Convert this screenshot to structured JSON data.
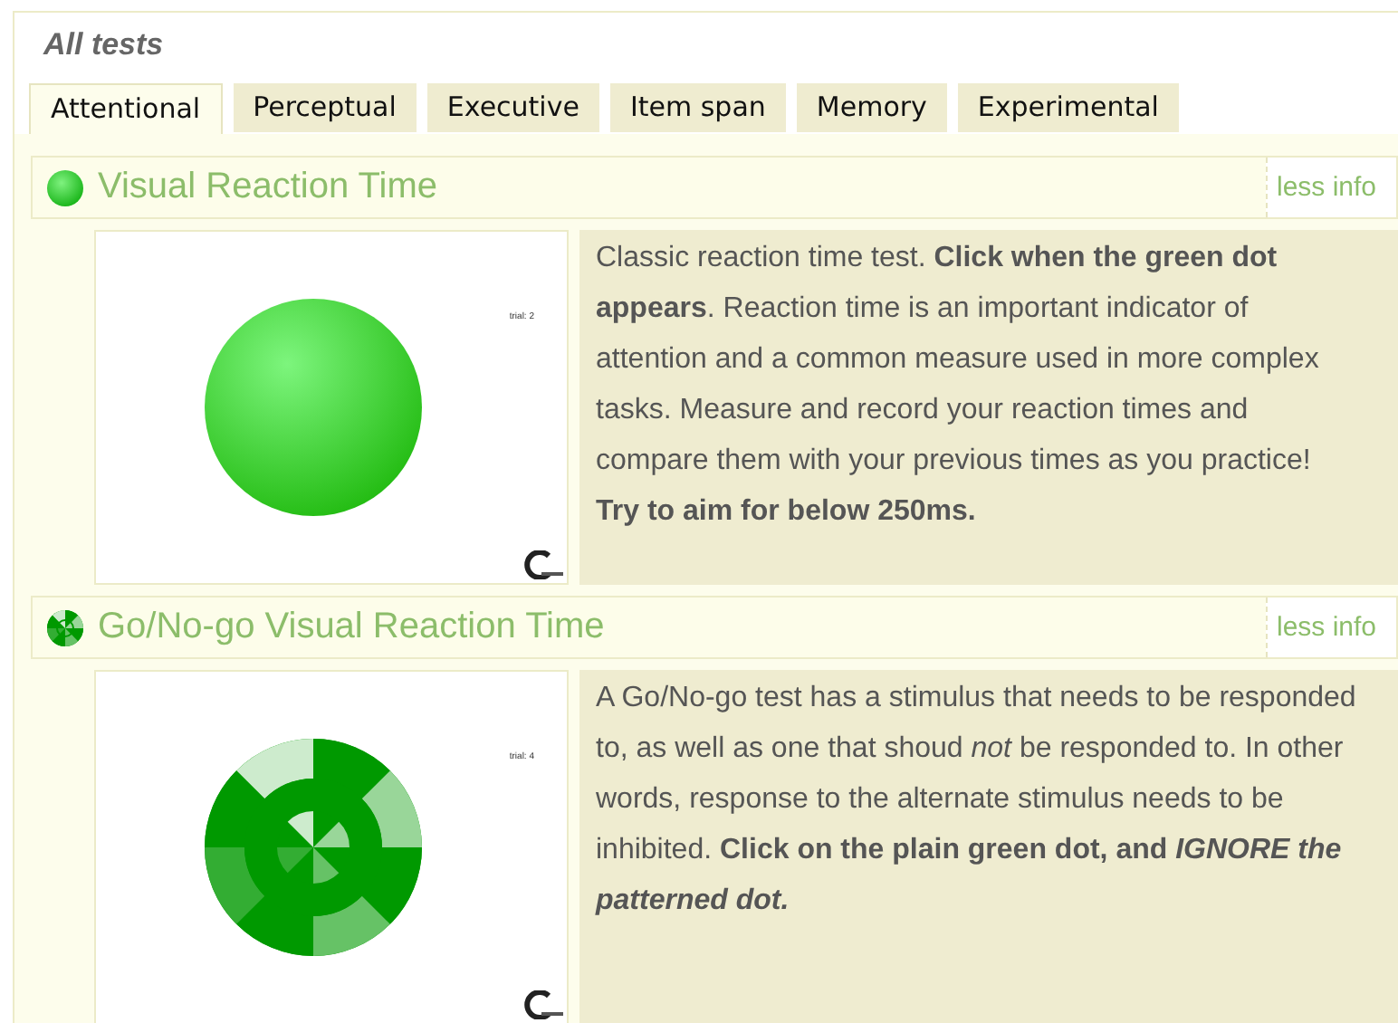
{
  "heading": "All tests",
  "tabs": [
    {
      "label": "Attentional",
      "selected": true
    },
    {
      "label": "Perceptual",
      "selected": false
    },
    {
      "label": "Executive",
      "selected": false
    },
    {
      "label": "Item span",
      "selected": false
    },
    {
      "label": "Memory",
      "selected": false
    },
    {
      "label": "Experimental",
      "selected": false
    }
  ],
  "tests": [
    {
      "kind": "plain",
      "title": "Visual Reaction Time",
      "toggle": "less info",
      "trial_label": "trial: 2",
      "description": "Classic reaction time test. **Click when the green dot appears**. Reaction time is an important indicator of attention and a common measure used in more complex tasks. Measure and record your reaction times and compare them with your previous times as you practice! **Try to aim for below 250ms.**"
    },
    {
      "kind": "patterned",
      "title": "Go/No-go Visual Reaction Time",
      "toggle": "less info",
      "trial_label": "trial: 4",
      "description": "A Go/No-go test has a stimulus that needs to be responded to, as well as one that shoud *not* be responded to. In other words, response to the alternate stimulus needs to be inhibited. **Click on the plain green dot, and** *IGNORE the patterned dot.*"
    }
  ]
}
